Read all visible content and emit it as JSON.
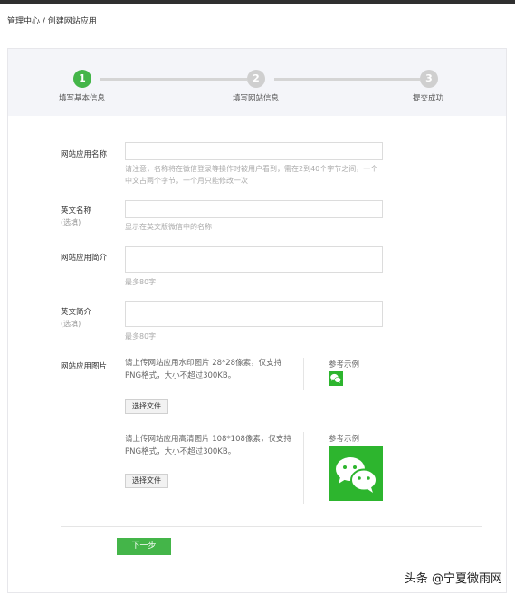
{
  "breadcrumb": "管理中心 / 创建网站应用",
  "steps": [
    {
      "number": "1",
      "label": "填写基本信息",
      "active": true
    },
    {
      "number": "2",
      "label": "填写网站信息",
      "active": false
    },
    {
      "number": "3",
      "label": "提交成功",
      "active": false
    }
  ],
  "form": {
    "app_name": {
      "label": "网站应用名称",
      "value": "",
      "hint": "请注意，名称将在微信登录等操作时被用户看到，需在2到40个字节之间，一个中文占两个字节，一个月只能修改一次"
    },
    "en_name": {
      "label": "英文名称",
      "sub": "(选填)",
      "value": "",
      "hint": "显示在英文版微信中的名称"
    },
    "intro": {
      "label": "网站应用简介",
      "value": "",
      "hint": "最多80字"
    },
    "en_intro": {
      "label": "英文简介",
      "sub": "(选填)",
      "value": "",
      "hint": "最多80字"
    },
    "images": {
      "label": "网站应用图片",
      "watermark": {
        "text": "请上传网站应用水印图片 28*28像素，仅支持PNG格式，大小不超过300KB。",
        "button": "选择文件",
        "ref_label": "参考示例"
      },
      "hd": {
        "text": "请上传网站应用高清图片 108*108像素，仅支持PNG格式，大小不超过300KB。",
        "button": "选择文件",
        "ref_label": "参考示例"
      }
    }
  },
  "next_button": "下一步",
  "watermark_text": "头条 @宁夏微雨网",
  "colors": {
    "accent": "#44b549",
    "logo": "#2db52e"
  }
}
